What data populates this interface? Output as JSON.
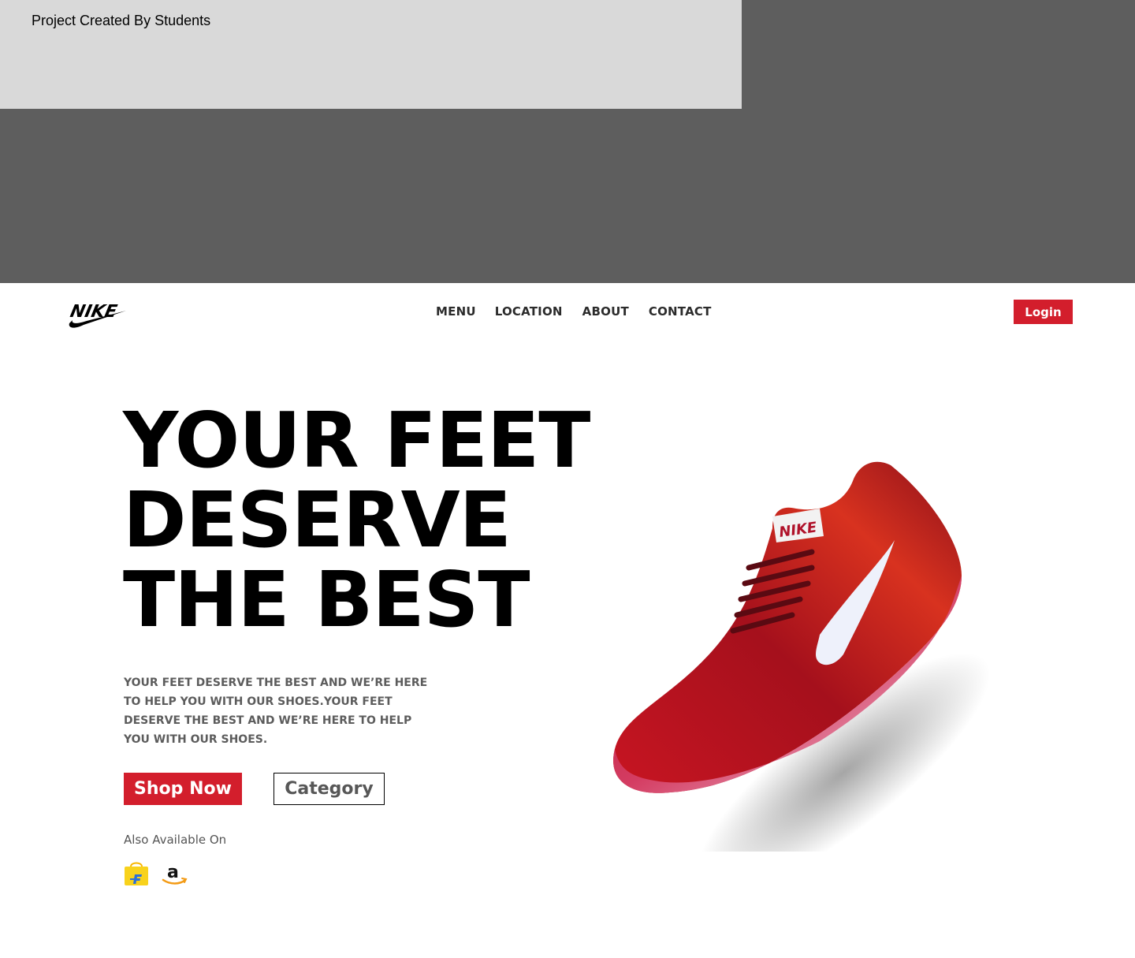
{
  "banner": {
    "text": "Project Created By Students"
  },
  "header": {
    "logo_text": "NIKE",
    "nav": [
      {
        "label": "MENU"
      },
      {
        "label": "LOCATION"
      },
      {
        "label": "ABOUT"
      },
      {
        "label": "CONTACT"
      }
    ],
    "login_label": "Login"
  },
  "hero": {
    "title_lines": [
      "YOUR FEET",
      "DESERVE",
      "THE BEST"
    ],
    "description": "YOUR FEET DESERVE THE BEST AND WE’RE HERE TO HELP YOU WITH OUR SHOES.YOUR FEET DESERVE THE BEST AND WE’RE HERE TO HELP YOU WITH OUR SHOES.",
    "shop_label": "Shop Now",
    "category_label": "Category",
    "also_label": "Also Available On",
    "stores": [
      {
        "icon": "flipkart-icon"
      },
      {
        "icon": "amazon-icon"
      }
    ],
    "product_image": "red-running-shoe"
  },
  "colors": {
    "accent": "#d31e2c",
    "banner_dark": "#5e5e5e",
    "banner_light": "#d9d9d9"
  }
}
